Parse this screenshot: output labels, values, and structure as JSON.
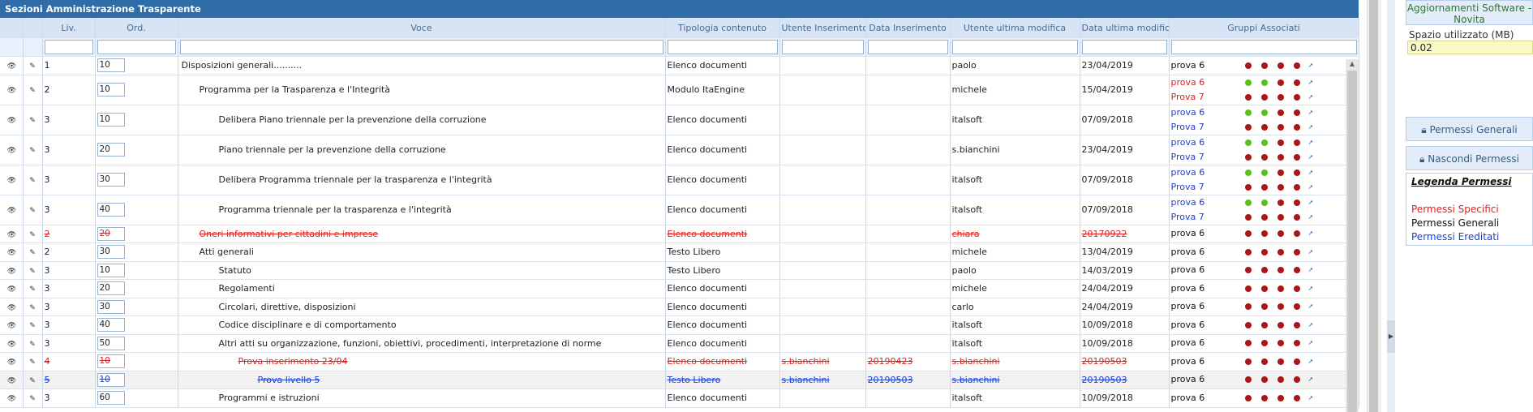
{
  "panel": {
    "title": "Sezioni Amministrazione Trasparente"
  },
  "columns": {
    "liv": "Liv.",
    "ord": "Ord.",
    "voce": "Voce",
    "tipologia": "Tipologia contenuto",
    "utente_ins": "Utente Inserimento",
    "data_ins": "Data Inserimento",
    "utente_mod": "Utente ultima modifica",
    "data_mod": "Data ultima modific",
    "gruppi": "Gruppi Associati"
  },
  "rows": [
    {
      "liv": "1",
      "ord": "10",
      "voce": "Disposizioni generali..........",
      "tipo": "Elenco documenti",
      "uins": "",
      "dins": "",
      "umod": "paolo",
      "dmod": "23/04/2019",
      "groups": [
        {
          "name": "prova 6",
          "color": "black",
          "dots": [
            "red",
            "red",
            "red",
            "red"
          ]
        }
      ]
    },
    {
      "liv": "2",
      "ord": "10",
      "voce": "Programma per la Trasparenza e l'Integrità",
      "tipo": "Modulo ItaEngine",
      "uins": "",
      "dins": "",
      "umod": "michele",
      "dmod": "15/04/2019",
      "groups": [
        {
          "name": "prova 6",
          "color": "red",
          "dots": [
            "green",
            "green",
            "red",
            "red"
          ]
        },
        {
          "name": "Prova 7",
          "color": "red",
          "dots": [
            "red",
            "red",
            "red",
            "red"
          ]
        }
      ]
    },
    {
      "liv": "3",
      "ord": "10",
      "voce": "Delibera Piano triennale per la prevenzione della corruzione",
      "tipo": "Elenco documenti",
      "uins": "",
      "dins": "",
      "umod": "italsoft",
      "dmod": "07/09/2018",
      "groups": [
        {
          "name": "prova 6",
          "color": "blue",
          "dots": [
            "green",
            "green",
            "red",
            "red"
          ]
        },
        {
          "name": "Prova 7",
          "color": "blue",
          "dots": [
            "red",
            "red",
            "red",
            "red"
          ]
        }
      ]
    },
    {
      "liv": "3",
      "ord": "20",
      "voce": "Piano triennale per la prevenzione della corruzione",
      "tipo": "Elenco documenti",
      "uins": "",
      "dins": "",
      "umod": "s.bianchini",
      "dmod": "23/04/2019",
      "groups": [
        {
          "name": "prova 6",
          "color": "blue",
          "dots": [
            "green",
            "green",
            "red",
            "red"
          ]
        },
        {
          "name": "Prova 7",
          "color": "blue",
          "dots": [
            "red",
            "red",
            "red",
            "red"
          ]
        }
      ]
    },
    {
      "liv": "3",
      "ord": "30",
      "voce": "Delibera Programma triennale per la trasparenza e l'integrità",
      "tipo": "Elenco documenti",
      "uins": "",
      "dins": "",
      "umod": "italsoft",
      "dmod": "07/09/2018",
      "groups": [
        {
          "name": "prova 6",
          "color": "blue",
          "dots": [
            "green",
            "green",
            "red",
            "red"
          ]
        },
        {
          "name": "Prova 7",
          "color": "blue",
          "dots": [
            "red",
            "red",
            "red",
            "red"
          ]
        }
      ]
    },
    {
      "liv": "3",
      "ord": "40",
      "voce": "Programma triennale per la trasparenza e l'integrità",
      "tipo": "Elenco documenti",
      "uins": "",
      "dins": "",
      "umod": "italsoft",
      "dmod": "07/09/2018",
      "groups": [
        {
          "name": "prova 6",
          "color": "blue",
          "dots": [
            "green",
            "green",
            "red",
            "red"
          ]
        },
        {
          "name": "Prova 7",
          "color": "blue",
          "dots": [
            "red",
            "red",
            "red",
            "red"
          ]
        }
      ]
    },
    {
      "liv": "2",
      "ord": "20",
      "voce": "Oneri informativi per cittadini e imprese",
      "tipo": "Elenco documenti",
      "uins": "",
      "dins": "",
      "umod": "chiara",
      "dmod": "20170922",
      "state": "deleted",
      "groups": [
        {
          "name": "prova 6",
          "color": "black",
          "dots": [
            "red",
            "red",
            "red",
            "red"
          ]
        }
      ]
    },
    {
      "liv": "2",
      "ord": "30",
      "voce": "Atti generali",
      "tipo": "Testo Libero",
      "uins": "",
      "dins": "",
      "umod": "michele",
      "dmod": "13/04/2019",
      "groups": [
        {
          "name": "prova 6",
          "color": "black",
          "dots": [
            "red",
            "red",
            "red",
            "red"
          ]
        }
      ]
    },
    {
      "liv": "3",
      "ord": "10",
      "voce": "Statuto",
      "tipo": "Testo Libero",
      "uins": "",
      "dins": "",
      "umod": "paolo",
      "dmod": "14/03/2019",
      "groups": [
        {
          "name": "prova 6",
          "color": "black",
          "dots": [
            "red",
            "red",
            "red",
            "red"
          ]
        }
      ]
    },
    {
      "liv": "3",
      "ord": "20",
      "voce": "Regolamenti",
      "tipo": "Elenco documenti",
      "uins": "",
      "dins": "",
      "umod": "michele",
      "dmod": "24/04/2019",
      "groups": [
        {
          "name": "prova 6",
          "color": "black",
          "dots": [
            "red",
            "red",
            "red",
            "red"
          ]
        }
      ]
    },
    {
      "liv": "3",
      "ord": "30",
      "voce": "Circolari, direttive, disposizioni",
      "tipo": "Elenco documenti",
      "uins": "",
      "dins": "",
      "umod": "carlo",
      "dmod": "24/04/2019",
      "groups": [
        {
          "name": "prova 6",
          "color": "black",
          "dots": [
            "red",
            "red",
            "red",
            "red"
          ]
        }
      ]
    },
    {
      "liv": "3",
      "ord": "40",
      "voce": "Codice disciplinare e di comportamento",
      "tipo": "Elenco documenti",
      "uins": "",
      "dins": "",
      "umod": "italsoft",
      "dmod": "10/09/2018",
      "groups": [
        {
          "name": "prova 6",
          "color": "black",
          "dots": [
            "red",
            "red",
            "red",
            "red"
          ]
        }
      ]
    },
    {
      "liv": "3",
      "ord": "50",
      "voce": "Altri atti su organizzazione, funzioni, obiettivi, procedimenti, interpretazione di norme",
      "tipo": "Elenco documenti",
      "uins": "",
      "dins": "",
      "umod": "italsoft",
      "dmod": "10/09/2018",
      "groups": [
        {
          "name": "prova 6",
          "color": "black",
          "dots": [
            "red",
            "red",
            "red",
            "red"
          ]
        }
      ]
    },
    {
      "liv": "4",
      "ord": "10",
      "voce": "Prova inserimento 23/04",
      "tipo": "Elenco documenti",
      "uins": "s.bianchini",
      "dins": "20190423",
      "umod": "s.bianchini",
      "dmod": "20190503",
      "state": "deleted",
      "groups": [
        {
          "name": "prova 6",
          "color": "black",
          "dots": [
            "red",
            "red",
            "red",
            "red"
          ]
        }
      ]
    },
    {
      "liv": "5",
      "ord": "10",
      "voce": "Prova livello 5",
      "tipo": "Testo Libero",
      "uins": "s.bianchini",
      "dins": "20190503",
      "umod": "s.bianchini",
      "dmod": "20190503",
      "state": "moved",
      "groups": [
        {
          "name": "prova 6",
          "color": "black",
          "dots": [
            "red",
            "red",
            "red",
            "red"
          ]
        }
      ]
    },
    {
      "liv": "3",
      "ord": "60",
      "voce": "Programmi e istruzioni",
      "tipo": "Elenco documenti",
      "uins": "",
      "dins": "",
      "umod": "italsoft",
      "dmod": "10/09/2018",
      "groups": [
        {
          "name": "prova 6",
          "color": "black",
          "dots": [
            "red",
            "red",
            "red",
            "red"
          ]
        }
      ]
    }
  ],
  "side": {
    "updates_label": "Aggiornamenti Software - Novita",
    "space_label": "Spazio utilizzato (MB)",
    "space_value": "0.02",
    "perm_general": "Permessi Generali",
    "perm_hide": "Nascondi Permessi",
    "legend_title": "Legenda Permessi",
    "legend_specific": "Permessi Specifici",
    "legend_general": "Permessi Generali",
    "legend_inherited": "Permessi Ereditati"
  },
  "colors": {
    "header_blue": "#2f6da8",
    "specific_red": "#e02020",
    "inherited_blue": "#1d3fd0",
    "dot_red": "#a81818",
    "dot_green": "#5cbf1f"
  }
}
